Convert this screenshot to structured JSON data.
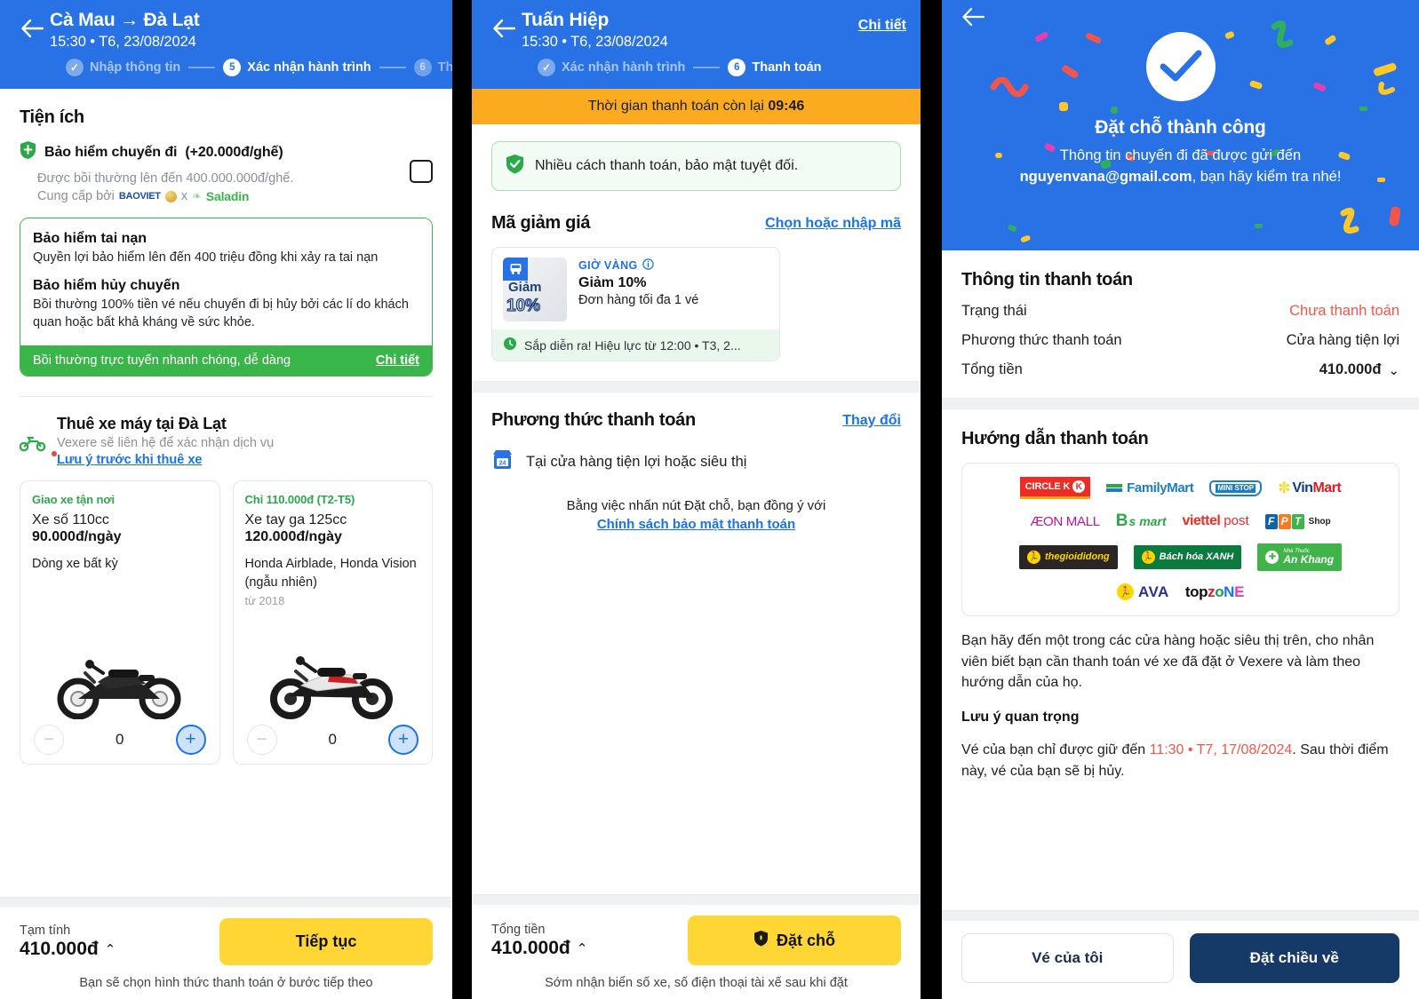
{
  "panel1": {
    "header": {
      "back_icon": "back-arrow-icon",
      "title": "Cà Mau → Đà Lạt",
      "subtitle": "15:30 • T6, 23/08/2024",
      "steps": [
        {
          "badge": "✓",
          "label": "Nhập thông tin",
          "state": "done"
        },
        {
          "badge": "5",
          "label": "Xác nhận hành trình",
          "state": "active"
        },
        {
          "badge": "6",
          "label": "Thanh",
          "state": "future"
        }
      ]
    },
    "section_title": "Tiện ích",
    "insurance": {
      "shield_icon": "shield-icon",
      "title": "Bảo hiểm chuyến đi",
      "title_suffix": "(+20.000đ/ghế)",
      "sub": "Được bồi thường lên đến 400.000.000đ/ghế.",
      "provider_prefix": "Cung cấp bởi",
      "provider_1": "BAOVIET",
      "provider_sep": "x",
      "provider_2": "Saladin",
      "checkbox_checked": false,
      "benefit_1_title": "Bảo hiểm tai nạn",
      "benefit_1_body": "Quyền lợi bảo hiểm lên đến 400 triệu đồng khi xảy ra tai nạn",
      "benefit_2_title": "Bảo hiểm hủy chuyến",
      "benefit_2_body": "Bồi thường 100% tiền vé nếu chuyến đi bị hủy bởi các lí do khách quan hoặc bất khả kháng về sức khỏe.",
      "banner_text": "Bồi thường trực tuyến nhanh chóng, dễ dàng",
      "banner_link": "Chi tiết",
      "accent_green": "#3ab54a"
    },
    "bike": {
      "icon": "motorbike-icon",
      "title": "Thuê xe máy tại Đà Lạt",
      "sub": "Vexere sẽ liên hệ để xác nhận dịch vụ",
      "note_link": "Lưu ý trước khi thuê xe",
      "cards": [
        {
          "tag": "Giao xe tận nơi",
          "name": "Xe số 110cc",
          "price": "90.000đ/ngày",
          "desc": "Dòng xe bất kỳ",
          "year": "",
          "qty": "0"
        },
        {
          "tag": "Chỉ 110.000đ (T2-T5)",
          "name": "Xe tay ga 125cc",
          "price": "120.000đ/ngày",
          "desc": "Honda Airblade, Honda Vision (ngẫu nhiên)",
          "year": "từ 2018",
          "qty": "0"
        }
      ],
      "minus_icon": "minus-icon",
      "plus_icon": "plus-icon"
    },
    "footer": {
      "label": "Tạm tính",
      "amount": "410.000đ",
      "caret": "⌃",
      "button": "Tiếp tục",
      "note": "Bạn sẽ chọn hình thức thanh toán ở bước tiếp theo",
      "button_color": "#ffd633"
    }
  },
  "panel2": {
    "header": {
      "back_icon": "back-arrow-icon",
      "title": "Tuấn Hiệp",
      "subtitle": "15:30 • T6, 23/08/2024",
      "detail_link": "Chi tiết",
      "steps": [
        {
          "badge": "✓",
          "label": "Xác nhận hành trình",
          "state": "done"
        },
        {
          "badge": "6",
          "label": "Thanh toán",
          "state": "active"
        }
      ]
    },
    "timer_prefix": "Thời gian thanh toán còn lại ",
    "timer_value": "09:46",
    "timer_color": "#fcaa1f",
    "secure_icon": "shield-check-icon",
    "secure_text": "Nhiều cách thanh toán, bảo mật tuyệt đối.",
    "voucher_section_title": "Mã giảm giá",
    "voucher_section_link": "Chọn hoặc nhập mã",
    "voucher": {
      "thumb_icon": "bus-icon",
      "thumb_line1": "Giảm",
      "thumb_line2": "10%",
      "kicker": "GIỜ VÀNG",
      "info_icon": "info-icon",
      "title": "Giảm 10%",
      "sub": "Đơn hàng tối đa 1 vé",
      "clock_icon": "clock-icon",
      "status": "Sắp diễn ra! Hiệu lực từ 12:00 • T3, 2..."
    },
    "method_section_title": "Phương thức thanh toán",
    "method_change_link": "Thay đổi",
    "method_icon": "store-24-icon",
    "method_label": "Tại cửa hàng tiện lợi hoặc siêu thị",
    "agree_line": "Bằng việc nhấn nút Đặt chỗ, bạn đồng ý với",
    "agree_link": "Chính sách bảo mật thanh toán",
    "footer": {
      "label": "Tổng tiền",
      "amount": "410.000đ",
      "caret": "⌃",
      "button": "Đặt chỗ",
      "button_icon": "shield-icon",
      "note": "Sớm nhận biển số xe, số điện thoại tài xế sau khi đặt",
      "button_color": "#ffd633"
    }
  },
  "panel3": {
    "back_icon": "back-arrow-icon",
    "check_icon": "check-circle-icon",
    "hero_title": "Đặt chỗ thành công",
    "hero_sub_line1": "Thông tin chuyến đi đã được gửi đến",
    "hero_email": "nguyenvana@gmail.com",
    "hero_sub_line2": ", bạn hãy kiểm tra nhé!",
    "hero_color": "#2872e6",
    "payment_info_title": "Thông tin thanh toán",
    "rows": [
      {
        "key": "Trạng thái",
        "value": "Chưa thanh toán",
        "style": "red"
      },
      {
        "key": "Phương thức thanh toán",
        "value": "Cửa hàng tiện lợi",
        "style": "normal"
      },
      {
        "key": "Tổng tiền",
        "value": "410.000đ",
        "style": "bold",
        "caret": "⌄"
      }
    ],
    "guide_title": "Hướng dẫn thanh toán",
    "store_logos": [
      [
        "CIRCLE K",
        "FamilyMart",
        "MINI STOP",
        "VinMart"
      ],
      [
        "ÆON MALL",
        "B's mart",
        "viettel post",
        "FPT Shop"
      ],
      [
        "thegioididong",
        "Bách hóa XANH",
        "An Khang"
      ],
      [
        "AVA",
        "topzone"
      ]
    ],
    "guide_para": "Bạn hãy đến một trong các cửa hàng hoặc siêu thị trên, cho nhân viên biết bạn cần thanh toán vé xe đã đặt ở Vexere và làm theo hướng dẫn của họ.",
    "note_title": "Lưu ý quan trọng",
    "note_prefix": "Vé của bạn chỉ được giữ đến ",
    "note_deadline": "11:30 • T7, 17/08/2024",
    "note_suffix": ". Sau thời điểm này, vé của bạn sẽ bị hủy.",
    "note_color": "#f0564a",
    "btn_secondary": "Vé của tôi",
    "btn_primary": "Đặt chiều về",
    "btn_primary_color": "#163a68"
  }
}
